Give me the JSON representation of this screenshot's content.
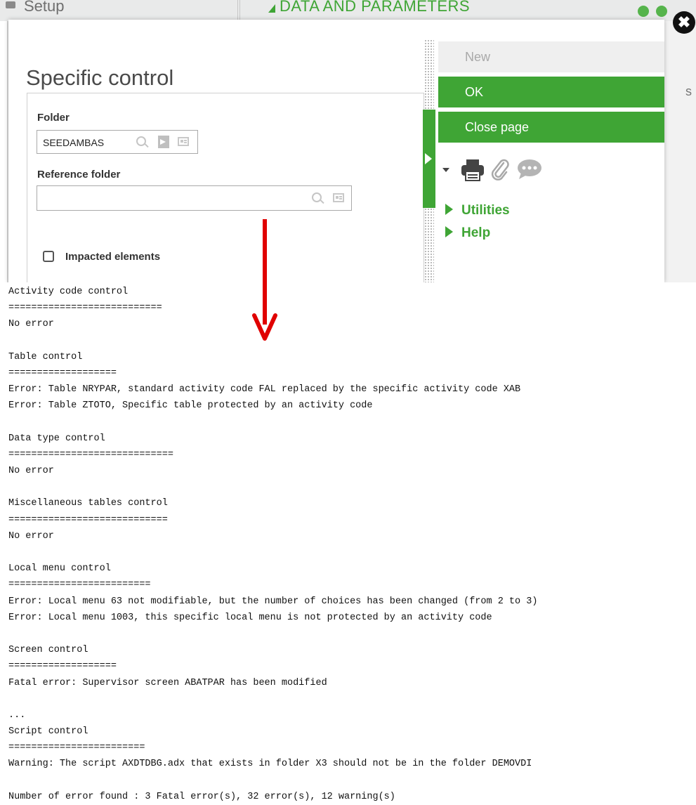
{
  "background": {
    "setup_label": "Setup",
    "section_label": "DATA AND PARAMETERS",
    "right_letter": "s"
  },
  "modal": {
    "title": "Specific control",
    "folder_label": "Folder",
    "folder_value": "SEEDAMBAS",
    "reference_label": "Reference folder",
    "reference_value": "",
    "impacted_label": "Impacted elements",
    "impacted_checked": false,
    "actions": {
      "new": "New",
      "ok": "OK",
      "close": "Close page"
    },
    "links": {
      "utilities": "Utilities",
      "help": "Help"
    }
  },
  "colors": {
    "accent_green": "#3fa535",
    "arrow_red": "#e00000",
    "disabled_gray": "#efefef"
  },
  "log": [
    "Activity code control",
    "===========================",
    "No error",
    "",
    "Table control",
    "===================",
    "Error: Table NRYPAR, standard activity code FAL replaced by the specific activity code XAB",
    "Error: Table ZTOTO, Specific table protected by an activity code",
    "",
    "Data type control",
    "=============================",
    "No error",
    "",
    "Miscellaneous tables control",
    "============================",
    "No error",
    "",
    "Local menu control",
    "=========================",
    "Error: Local menu 63 not modifiable, but the number of choices has been changed (from 2 to 3)",
    "Error: Local menu 1003, this specific local menu is not protected by an activity code",
    "",
    "Screen control",
    "===================",
    "Fatal error: Supervisor screen ABATPAR has been modified",
    "",
    "...",
    "Script control",
    "========================",
    "Warning: The script AXDTDBG.adx that exists in folder X3 should not be in the folder DEMOVDI",
    "",
    "Number of error found : 3 Fatal error(s), 32 error(s), 12 warning(s)"
  ]
}
